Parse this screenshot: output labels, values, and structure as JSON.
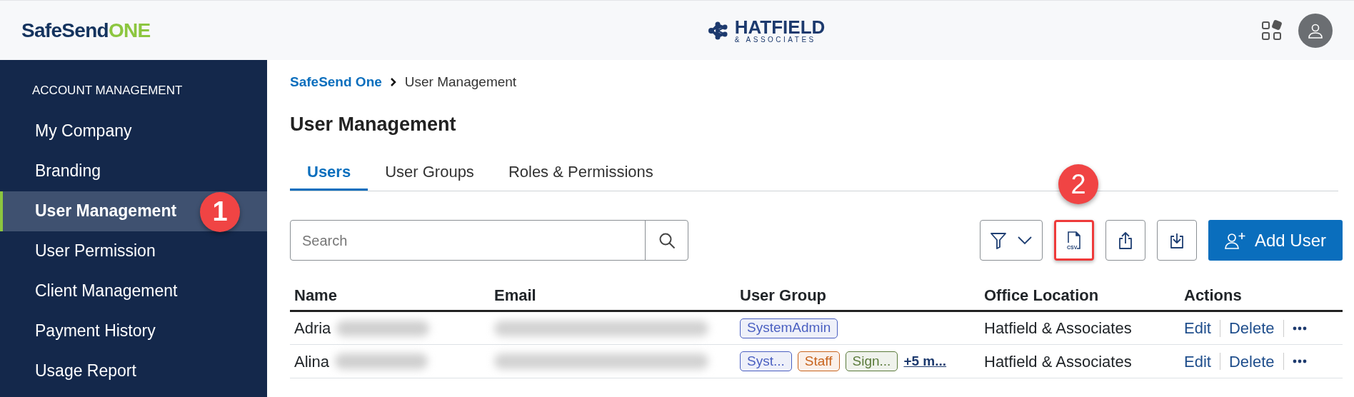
{
  "header": {
    "logo": {
      "brand": "SafeSend",
      "suffix": "ONE"
    },
    "company_logo": {
      "name": "HATFIELD",
      "tagline": "& ASSOCIATES"
    }
  },
  "sidebar": {
    "section": "ACCOUNT MANAGEMENT",
    "items": [
      {
        "label": "My Company",
        "selected": false
      },
      {
        "label": "Branding",
        "selected": false
      },
      {
        "label": "User Management",
        "selected": true,
        "callout": "1"
      },
      {
        "label": "User Permission",
        "selected": false
      },
      {
        "label": "Client Management",
        "selected": false
      },
      {
        "label": "Payment History",
        "selected": false
      },
      {
        "label": "Usage Report",
        "selected": false
      }
    ]
  },
  "breadcrumb": [
    {
      "label": "SafeSend One",
      "kind": "link"
    },
    {
      "label": "User Management",
      "kind": "current"
    }
  ],
  "page_title": "User Management",
  "tabs": [
    {
      "label": "Users",
      "selected": true
    },
    {
      "label": "User Groups",
      "selected": false
    },
    {
      "label": "Roles & Permissions",
      "selected": false
    }
  ],
  "search": {
    "placeholder": "Search"
  },
  "toolbar": [
    {
      "kind": "filter",
      "highlighted": false
    },
    {
      "kind": "csv",
      "label": "CSV",
      "highlighted": true,
      "callout": "2"
    },
    {
      "kind": "upload",
      "highlighted": false
    },
    {
      "kind": "download",
      "highlighted": false
    }
  ],
  "add_button": {
    "label": "Add User"
  },
  "table": {
    "columns": [
      "Name",
      "Email",
      "User Group",
      "Office Location",
      "Actions"
    ],
    "rows": [
      {
        "name": "Adria",
        "blurred": true,
        "groups": [
          {
            "label": "SystemAdmin",
            "color": "#4a5fc1"
          }
        ],
        "office": "Hatfield & Associates",
        "actions": [
          "Edit",
          "Delete"
        ]
      },
      {
        "name": "Alina",
        "blurred": true,
        "groups": [
          {
            "label": "Syst...",
            "color": "#4a5fc1"
          },
          {
            "label": "Staff",
            "color": "#c8641e"
          },
          {
            "label": "Sign...",
            "color": "#5a7a3a"
          }
        ],
        "more": "+5 m...",
        "office": "Hatfield & Associates",
        "actions": [
          "Edit",
          "Delete"
        ]
      }
    ]
  }
}
